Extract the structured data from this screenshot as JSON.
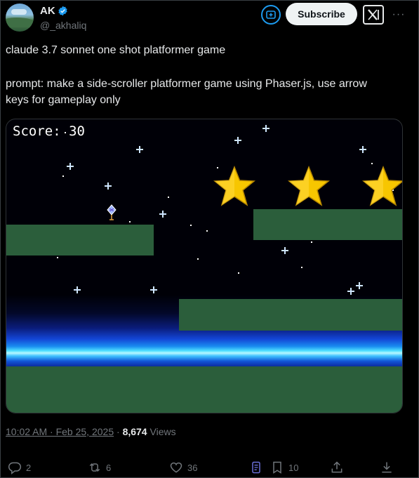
{
  "author": {
    "name": "AK",
    "handle": "@_akhaliq",
    "verified_color": "#1d9bf0"
  },
  "header": {
    "subscribe_label": "Subscribe",
    "grok_icon": "grok-icon",
    "x_logo": "x-logo",
    "more_label": "···"
  },
  "tweet": {
    "line1": "claude 3.7 sonnet one shot platformer game",
    "line2": "prompt: make a side-scroller platformer game using Phaser.js, use arrow",
    "line3": "keys for gameplay only"
  },
  "game": {
    "score_text": "Score: 30",
    "platform_color": "#2b5e3b",
    "star_color": "#f7c600"
  },
  "meta": {
    "time": "10:02 AM · Feb 25, 2025",
    "separator": " · ",
    "views_count": "8,674",
    "views_label": " Views"
  },
  "actions": {
    "replies": "2",
    "reposts": "6",
    "likes": "36",
    "bookmarks": "10"
  }
}
